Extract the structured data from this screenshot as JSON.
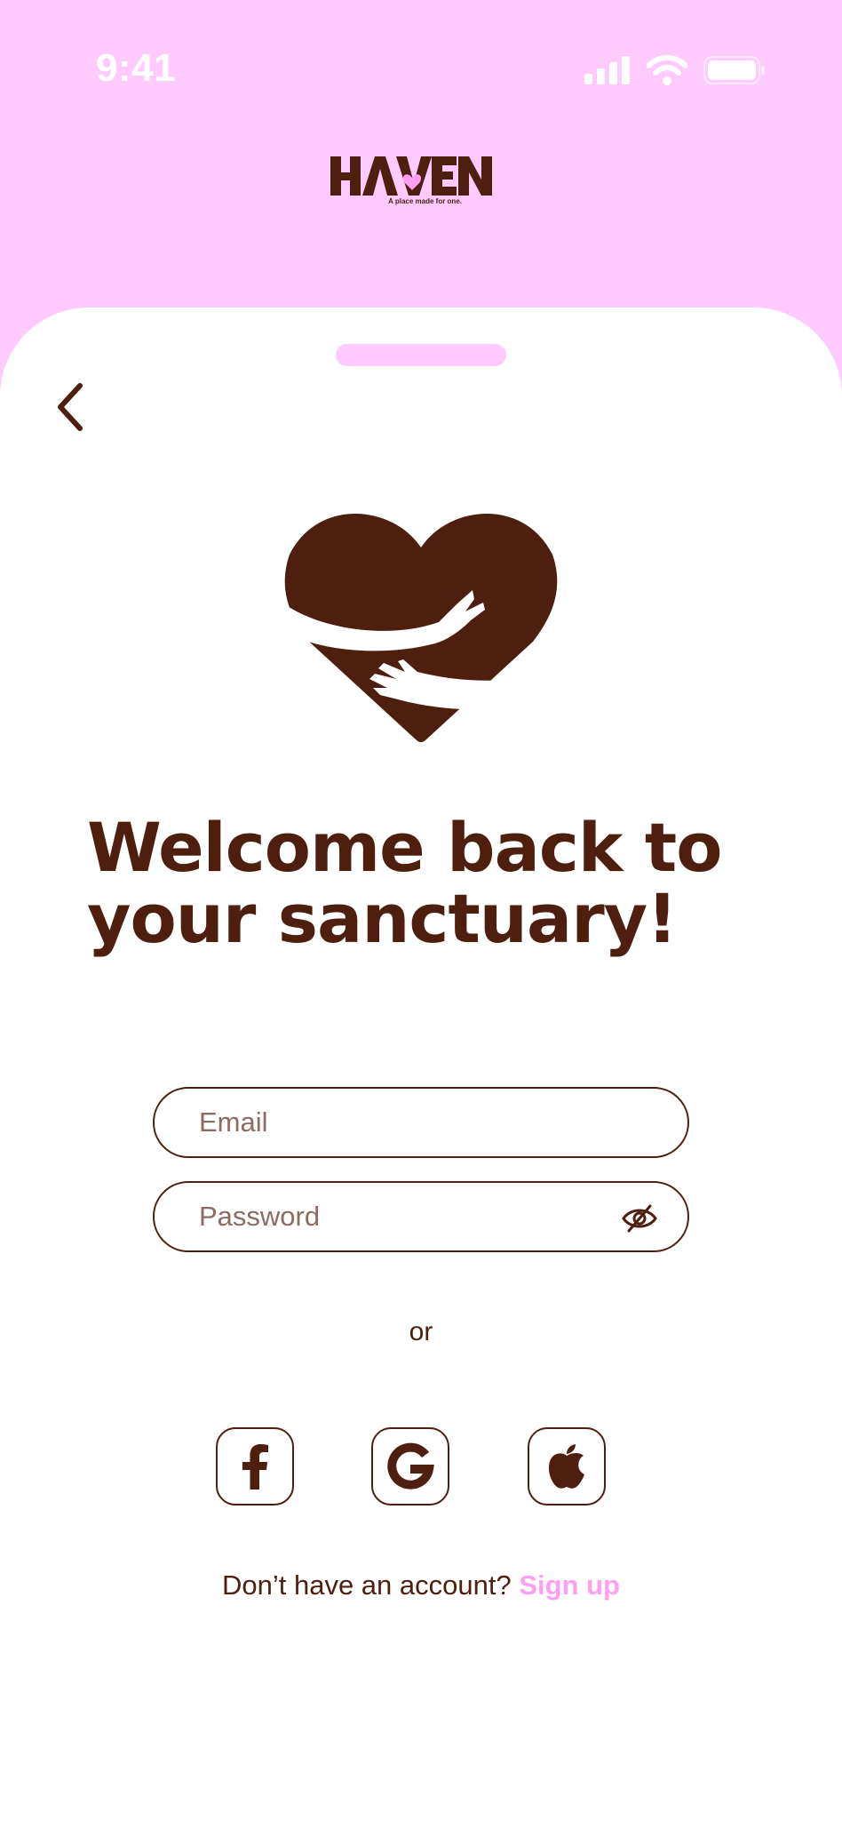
{
  "status_bar": {
    "time": "9:41"
  },
  "brand": {
    "name": "HAVEN",
    "tagline": "A place made for one."
  },
  "login": {
    "headline_line1": "Welcome back to",
    "headline_line2": "your sanctuary!",
    "email_placeholder": "Email",
    "password_placeholder": "Password",
    "divider": "or",
    "social": [
      {
        "name": "facebook",
        "icon": "facebook-icon"
      },
      {
        "name": "google",
        "icon": "google-icon"
      },
      {
        "name": "apple",
        "icon": "apple-icon"
      }
    ],
    "signup_prompt": "Don’t have an account?",
    "signup_link": "Sign up"
  },
  "colors": {
    "brand_pink": "#FFCBFE",
    "accent_pink": "#FF9FF3",
    "brown": "#4E1E0F",
    "white": "#FFFFFF"
  }
}
